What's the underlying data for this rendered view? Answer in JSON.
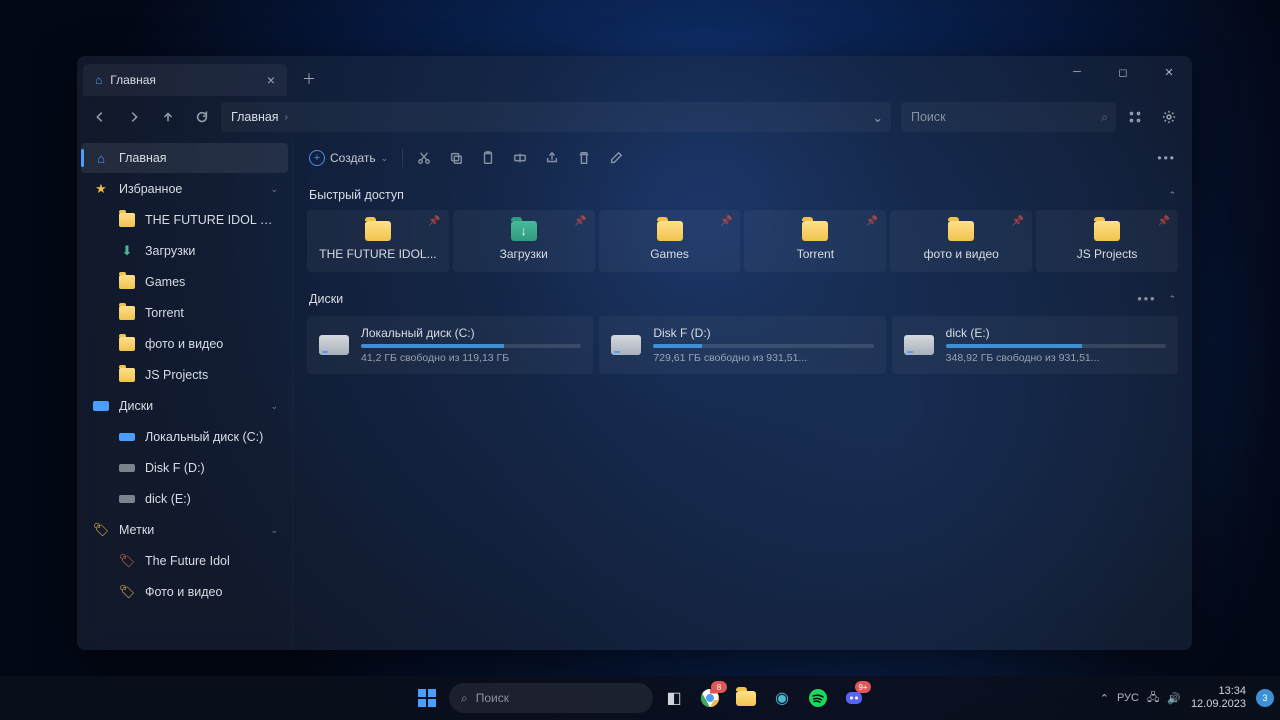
{
  "tab": {
    "title": "Главная"
  },
  "breadcrumb": {
    "root": "Главная"
  },
  "search": {
    "placeholder": "Поиск"
  },
  "toolbar": {
    "create": "Создать"
  },
  "sidebar": {
    "home": "Главная",
    "favorites": "Избранное",
    "favitems": [
      {
        "label": "THE FUTURE IDOL STUD",
        "type": "folder"
      },
      {
        "label": "Загрузки",
        "type": "download"
      },
      {
        "label": "Games",
        "type": "folder"
      },
      {
        "label": "Torrent",
        "type": "folder"
      },
      {
        "label": "фото и видео",
        "type": "folder"
      },
      {
        "label": "JS Projects",
        "type": "folder"
      }
    ],
    "disks": "Диски",
    "diskitems": [
      {
        "label": "Локальный диск (C:)",
        "type": "blue"
      },
      {
        "label": "Disk F (D:)",
        "type": "gray"
      },
      {
        "label": "dick (E:)",
        "type": "gray"
      }
    ],
    "tags": "Метки",
    "tagitems": [
      {
        "label": "The Future Idol",
        "color": "#e06b4a"
      },
      {
        "label": "Фото и видео",
        "color": "#f0b84d"
      }
    ]
  },
  "sections": {
    "quick": "Быстрый доступ",
    "quickitems": [
      {
        "label": "THE FUTURE IDOL...",
        "type": "folder"
      },
      {
        "label": "Загрузки",
        "type": "dl"
      },
      {
        "label": "Games",
        "type": "folder"
      },
      {
        "label": "Torrent",
        "type": "folder"
      },
      {
        "label": "фото и видео",
        "type": "folder"
      },
      {
        "label": "JS Projects",
        "type": "folder"
      }
    ],
    "disks": "Диски",
    "diskitems": [
      {
        "name": "Локальный диск (C:)",
        "free": "41,2 ГБ свободно из 119,13 ГБ",
        "pct": 65
      },
      {
        "name": "Disk F (D:)",
        "free": "729,61 ГБ свободно из 931,51...",
        "pct": 22
      },
      {
        "name": "dick (E:)",
        "free": "348,92 ГБ свободно из 931,51...",
        "pct": 62
      }
    ]
  },
  "taskbar": {
    "search": "Поиск",
    "lang": "РУС",
    "time": "13:34",
    "date": "12.09.2023",
    "notif": "3"
  }
}
